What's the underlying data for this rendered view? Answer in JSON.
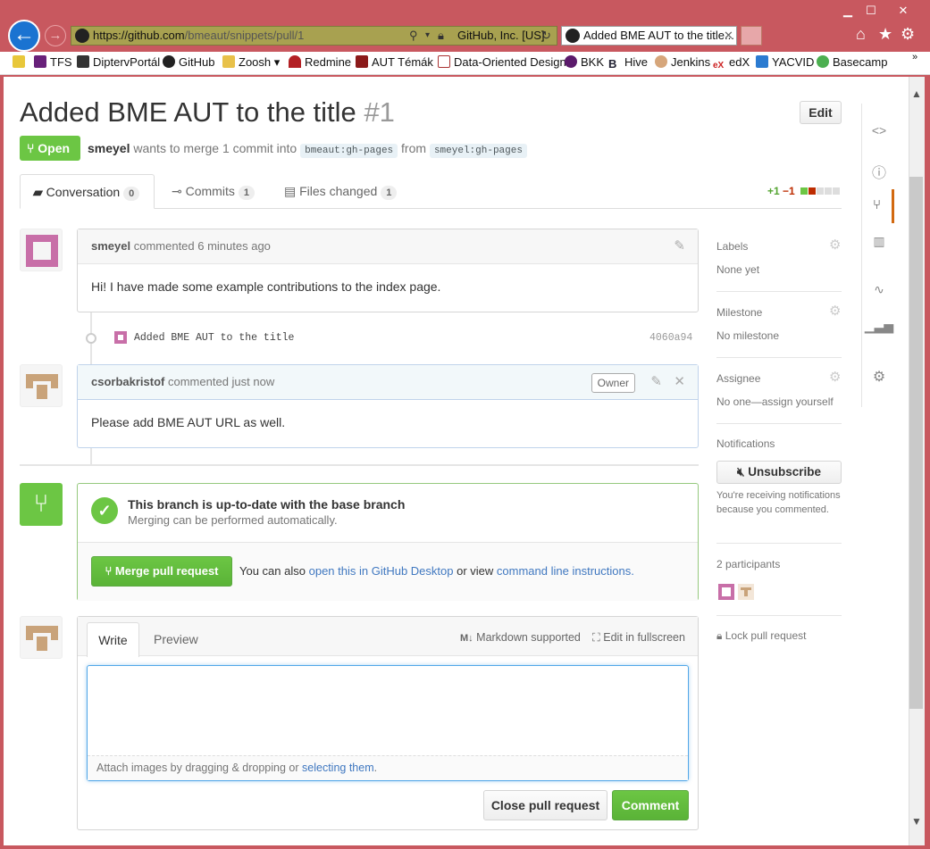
{
  "browser": {
    "url_host": "https://github.com",
    "url_path": "/bmeaut/snippets/pull/1",
    "cert": "GitHub, Inc. [US]",
    "tab_title": "Added BME AUT to the title..."
  },
  "favorites": [
    "TFS",
    "DiptervPortál",
    "GitHub",
    "Zoosh",
    "Redmine",
    "AUT Témák",
    "Data-Oriented Design",
    "BKK",
    "Hive",
    "Jenkins",
    "edX",
    "YACVID",
    "Basecamp"
  ],
  "pr": {
    "title": "Added BME AUT to the title",
    "number": "#1",
    "edit_label": "Edit",
    "state": "Open",
    "author": "smeyel",
    "merge_text": "wants to merge 1 commit into",
    "base_ref": "bmeaut:gh-pages",
    "from_text": "from",
    "head_ref": "smeyel:gh-pages"
  },
  "tabs": [
    {
      "label": "Conversation",
      "count": "0"
    },
    {
      "label": "Commits",
      "count": "1"
    },
    {
      "label": "Files changed",
      "count": "1"
    }
  ],
  "diffstat": {
    "add": "+1",
    "del": "−1"
  },
  "comments": [
    {
      "author": "smeyel",
      "time": "commented 6 minutes ago",
      "body": "Hi! I have made some example contributions to the index page."
    },
    {
      "author": "csorbakristof",
      "time": "commented just now",
      "badge": "Owner",
      "body": "Please add BME AUT URL as well."
    }
  ],
  "commit": {
    "message": "Added BME AUT to the title",
    "sha": "4060a94"
  },
  "merge": {
    "title": "This branch is up-to-date with the base branch",
    "subtitle": "Merging can be performed automatically.",
    "button": "Merge pull request",
    "also_text": "You can also",
    "desktop_link": "open this in GitHub Desktop",
    "or_text": "or view",
    "cli_link": "command line instructions",
    "end": "."
  },
  "composer": {
    "write_tab": "Write",
    "preview_tab": "Preview",
    "markdown": "Markdown supported",
    "fullscreen": "Edit in fullscreen",
    "attach_text": "Attach images by dragging & dropping or",
    "attach_link": "selecting them",
    "attach_end": ".",
    "close_button": "Close pull request",
    "comment_button": "Comment"
  },
  "sidebar": {
    "labels_h": "Labels",
    "labels_v": "None yet",
    "milestone_h": "Milestone",
    "milestone_v": "No milestone",
    "assignee_h": "Assignee",
    "assignee_v": "No one—assign yourself",
    "notifications_h": "Notifications",
    "unsubscribe": "Unsubscribe",
    "notif_text": "You're receiving notifications because you commented.",
    "participants": "2 participants",
    "lock": "Lock pull request"
  },
  "colors": {
    "open": "#6cc644",
    "link": "#4078c0",
    "chrome": "#c8585f"
  }
}
